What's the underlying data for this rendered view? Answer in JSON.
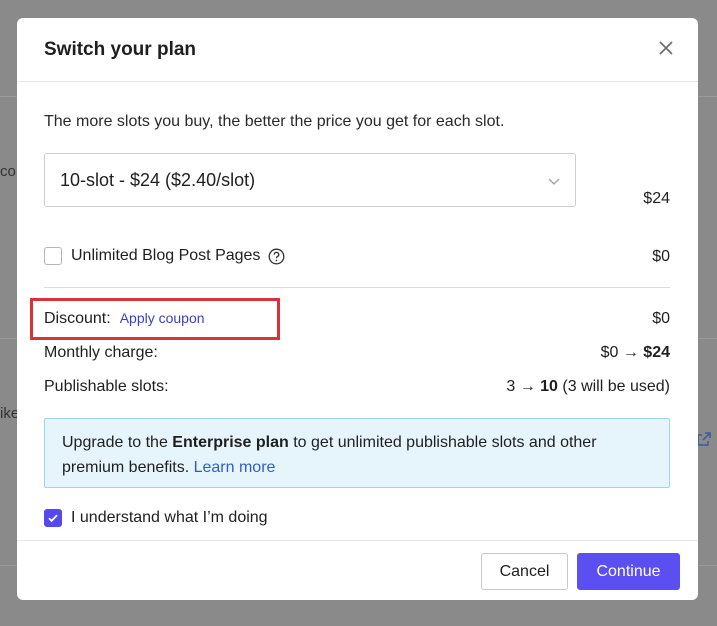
{
  "background": {
    "fragment_left_1": "co",
    "fragment_left_2": "ike"
  },
  "modal": {
    "title": "Switch your plan",
    "intro": "The more slots you buy, the better the price you get for each slot.",
    "plan_select": {
      "value": "10-slot - $24 ($2.40/slot)",
      "price": "$24"
    },
    "addon": {
      "label": "Unlimited Blog Post Pages",
      "checked": false,
      "price": "$0"
    },
    "discount": {
      "label": "Discount:",
      "link": "Apply coupon",
      "value": "$0"
    },
    "monthly_charge": {
      "label": "Monthly charge:",
      "from": "$0",
      "arrow": "→",
      "to": "$24"
    },
    "publishable_slots": {
      "label": "Publishable slots:",
      "from": "3",
      "arrow": "→",
      "to": "10",
      "note": "(3 will be used)"
    },
    "info": {
      "prefix": "Upgrade to the ",
      "plan": "Enterprise plan",
      "suffix": " to get unlimited publishable slots and other premium benefits. ",
      "link": "Learn more"
    },
    "confirm": {
      "label": "I understand what I’m doing",
      "checked": true
    },
    "buttons": {
      "cancel": "Cancel",
      "continue": "Continue"
    }
  },
  "colors": {
    "accent": "#5c4ff2",
    "highlight": "#d8323a",
    "info_bg": "#e6f4fc",
    "link": "#3a3fc7"
  }
}
